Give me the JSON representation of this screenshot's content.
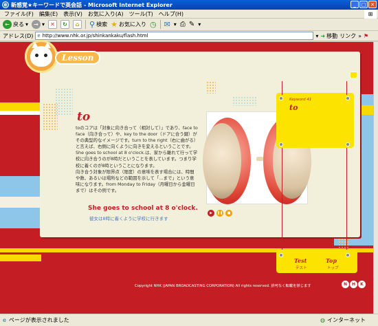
{
  "window": {
    "title": "新感覚★キーワードで英会話 - Microsoft Internet Explorer"
  },
  "menu": [
    "ファイル(F)",
    "編集(E)",
    "表示(V)",
    "お気に入り(A)",
    "ツール(T)",
    "ヘルプ(H)"
  ],
  "toolbar": {
    "back": "戻る",
    "search": "検索",
    "favorites": "お気に入り"
  },
  "address": {
    "label": "アドレス(D)",
    "url": "http://www.nhk.or.jp/shinkankaku/flash.html",
    "go": "移動",
    "links": "リンク"
  },
  "lesson": {
    "badge": "Lesson",
    "word": "to",
    "paragraphs": [
      "toのコアは「対象に向き合って（相対して）」であり、face to face（向き合って）や、key to the door（ドアに合う鍵）がその典型的なイメージです。turn to the right（右に曲がる）と言えば、右側に向くように向きを変えるということです。She goes to school at 8 o'clock.は、家から離れて行って学校に向き合うのが8時だということを表しています。つまり学校に着くのが8時ということになります。",
      "向き合う対象が限界点（限度）の意味を表す場合には、時間や数、あるいは場所などの範囲を示して「…まで」という意味になります。from Monday to Friday（月曜日から金曜日まで）はその例です。"
    ],
    "example_en": "She goes to school at 8 o'clock.",
    "example_ja": "彼女は8時に着くように学校に行きます"
  },
  "keyword_card": {
    "label": "Keyword 41",
    "word": "to"
  },
  "nav": {
    "test": "Test",
    "test_ja": "テスト",
    "top": "Top",
    "top_ja": "トップ"
  },
  "footer": {
    "copyright": "Copyright NHK (JAPAN BROADCASTING CORPORATION) All rights reserved.  許可なく転載を禁じます"
  },
  "status": {
    "text": "ページが表示されました",
    "zone": "インターネット"
  },
  "colors": {
    "accent": "#c41e24",
    "yellow": "#fde400",
    "blue": "#8dc6e8",
    "panel": "#f2efda"
  }
}
